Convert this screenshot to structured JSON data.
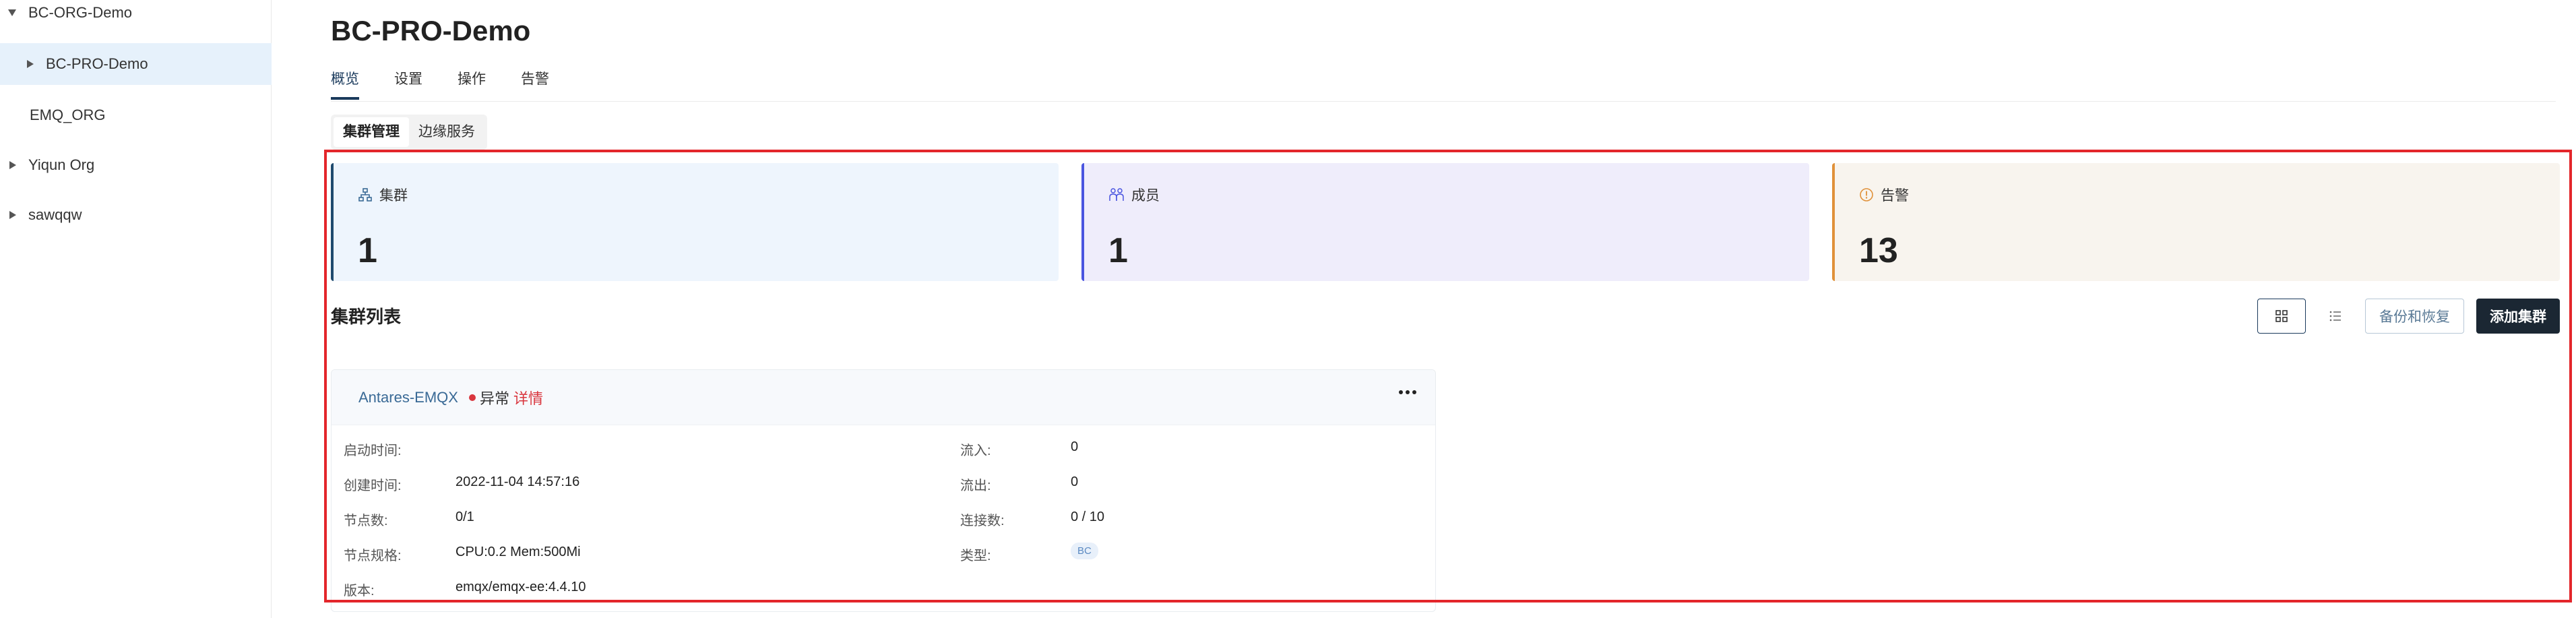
{
  "sidebar": {
    "items": [
      {
        "label": "BC-ORG-Demo",
        "arrow": "down"
      },
      {
        "label": "BC-PRO-Demo",
        "arrow": "right"
      },
      {
        "label": "EMQ_ORG",
        "arrow": ""
      },
      {
        "label": "Yiqun Org",
        "arrow": "right"
      },
      {
        "label": "sawqqw",
        "arrow": "right"
      }
    ]
  },
  "header": {
    "title": "BC-PRO-Demo",
    "tabs": [
      "概览",
      "设置",
      "操作",
      "告警"
    ]
  },
  "sub_tabs": [
    "集群管理",
    "边缘服务"
  ],
  "stats": {
    "clusters": {
      "label": "集群",
      "value": "1",
      "icon": "cluster-icon"
    },
    "members": {
      "label": "成员",
      "value": "1",
      "icon": "members-icon"
    },
    "alerts": {
      "label": "告警",
      "value": "13",
      "icon": "alert-icon"
    }
  },
  "list": {
    "title": "集群列表",
    "backup_label": "备份和恢复",
    "add_label": "添加集群"
  },
  "cluster": {
    "name": "Antares-EMQX",
    "status": "异常",
    "detail": "详情",
    "fields": {
      "start_time_label": "启动时间:",
      "start_time": "",
      "created_label": "创建时间:",
      "created": "2022-11-04 14:57:16",
      "nodes_label": "节点数:",
      "nodes": "0/1",
      "spec_label": "节点规格:",
      "spec": "CPU:0.2 Mem:500Mi",
      "version_label": "版本:",
      "version": "emqx/emqx-ee:4.4.10",
      "in_label": "流入:",
      "in": "0",
      "out_label": "流出:",
      "out": "0",
      "conn_label": "连接数:",
      "conn": "0 / 10",
      "type_label": "类型:",
      "type": "BC"
    }
  },
  "colors": {
    "accent": "#1a3a5c",
    "highlight": "#e3262b",
    "cluster_card_bg": "#eef5fd",
    "cluster_card_bar": "#1f4a6e",
    "members_card_bg": "#efedfb",
    "members_card_bar": "#4a55e0",
    "alerts_card_bg": "#f8f4ee",
    "alerts_card_bar": "#e0913a",
    "error": "#d9363e"
  }
}
